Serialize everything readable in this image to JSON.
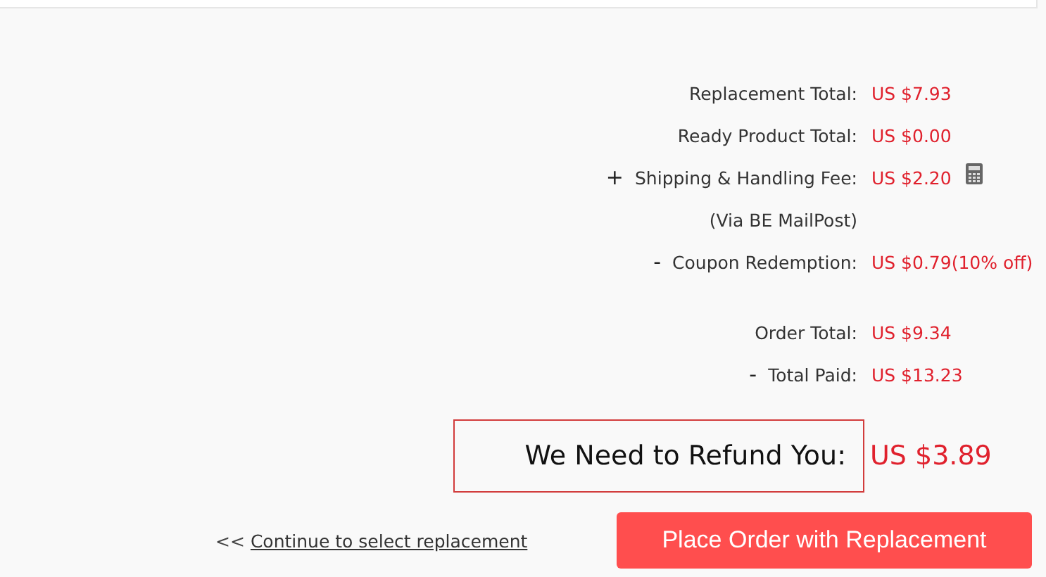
{
  "summary_groups": [
    {
      "rows": [
        {
          "kind": "plain",
          "label": "Replacement Total:",
          "value": "US $7.93"
        },
        {
          "kind": "plain",
          "label": "Ready Product Total:",
          "value": "US $0.00"
        },
        {
          "kind": "fee",
          "sign": "+",
          "label": "Shipping & Handling Fee:",
          "value": "US $2.20"
        },
        {
          "kind": "note",
          "label": "(Via BE MailPost)"
        },
        {
          "kind": "plain",
          "sign": "-",
          "label": "Coupon Redemption:",
          "value": "US $0.79(10% off)"
        }
      ]
    },
    {
      "rows": [
        {
          "kind": "plain",
          "label": "Order Total:",
          "value": "US $9.34"
        },
        {
          "kind": "plain",
          "sign": "-",
          "label": "Total Paid:",
          "value": "US $13.23"
        }
      ]
    }
  ],
  "refund": {
    "label": "We Need to Refund You:",
    "value": "US $3.89"
  },
  "back_link": {
    "prefix": "<<",
    "label": "Continue to select replacement"
  },
  "place_order_button": "Place Order with Replacement"
}
